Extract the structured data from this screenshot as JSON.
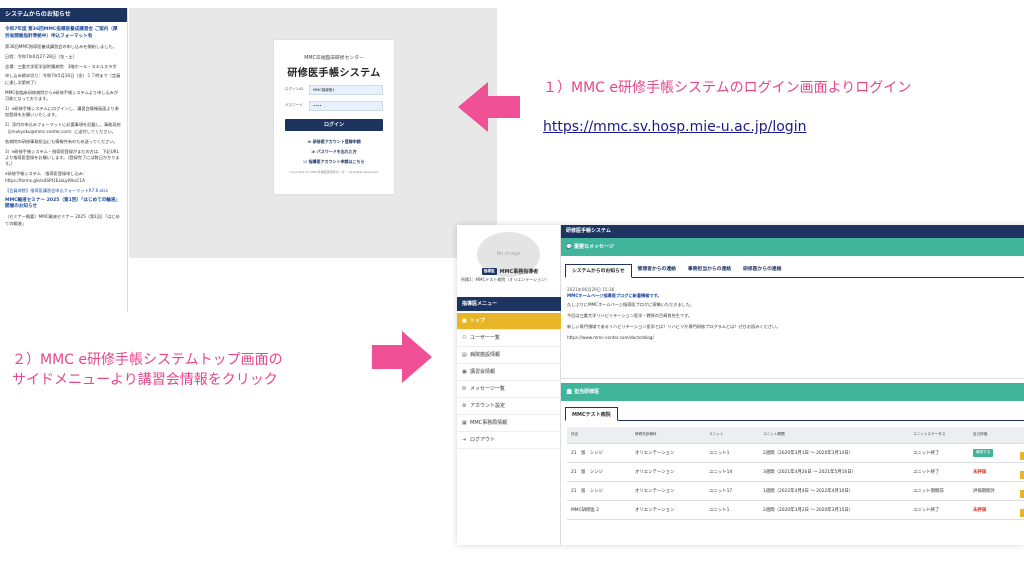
{
  "notice": {
    "header": "システムからのお知らせ",
    "items": [
      {
        "title": "令和7年度 第36回MMC指導医養成講習会 ご案内（厚労省開催指針準拠中）申込フォーマット有",
        "body": "第36回MMC指導医養成講習会の申し込みを開始しました。"
      },
      {
        "body": "日程：令和7年6月27-28日（金・土）"
      },
      {
        "body": "会場：三重大学医学部附属病院　3階ホール・スキルスラボ"
      },
      {
        "body": "申し込み締め切り：令和7年5月16日（金）１７時まで（定員に達し次第終了）"
      },
      {
        "body": "MMC各臨床研修病院からe研修手帳システムより申し込みが可能となっております。"
      },
      {
        "body": "1）e研修手帳システムにログインし、講習会情報画面より参加登録をお願いいたします。"
      },
      {
        "body": "2）添付の申込みフォーマットに必要事項を記載し、事務局宛（jimukyoku@mmc-center.com）に送付してください。"
      },
      {
        "body": "各病院の研修事務担当にも情報共有のため送ってください。"
      },
      {
        "body": "3）e研修手帳システム・指導医登録がまだの方は、下記URLより指導医登録をお願いします。（登録完了には数日かかります。）"
      },
      {
        "body": "e研修手帳システム　指導医登録申し込み：https://forms.gle/o4SPt1EzoLyt9ksC1A"
      },
      {
        "link": "【会員病院】指導医講習会申込フォーマットR7.6.xlsx"
      },
      {
        "title": "MMC輸液セミナー 2025（第1回）「はじめての輸液」開催のお知らせ",
        "body": "（セミナー概要）MMC輸液セミナー 2025（第1回）「はじめての輸液」"
      }
    ]
  },
  "login": {
    "subtitle": "MMC卒後臨床研修センター",
    "title": "研修医手帳システム",
    "id_label": "ログインID",
    "id_value": "MMC指導医1",
    "pw_label": "パスワード",
    "pw_value": "••••",
    "login_button": "ログイン",
    "link_register": "≫ 研修医アカウント登録申請",
    "link_forgot": "≫ パスワードを忘れた方",
    "link_guide": "☑ 指導医アカウント申請はこちら",
    "copyright": "Copyright (C) MMC卒後臨床研修センター All Rights Reserved."
  },
  "captions": {
    "step1": "１）MMC e研修手帳システムのログイン画面よりログイン",
    "url": "https://mmc.sv.hosp.mie-u.ac.jp/login",
    "step2_line1": "２）MMC e研修手帳システムトップ画面の",
    "step2_line2": "サイドメニューより講習会情報をクリック"
  },
  "app": {
    "header": "研修医手帳システム",
    "no_image": "No image",
    "role_badge": "指導医",
    "user_name": "MMC事務指導者",
    "institution": "所属1：MMCテスト病院（オリエンテーション）",
    "menu_header": "指導医メニュー",
    "menu": [
      {
        "icon": "■",
        "label": "トップ"
      },
      {
        "icon": "⚇",
        "label": "ユーザー一覧"
      },
      {
        "icon": "▤",
        "label": "病院施設情報"
      },
      {
        "icon": "▣",
        "label": "講習会情報"
      },
      {
        "icon": "✉",
        "label": "メッセージ一覧"
      },
      {
        "icon": "⚙",
        "label": "アカウント設定"
      },
      {
        "icon": "▦",
        "label": "MMC事務局情報"
      },
      {
        "icon": "⇥",
        "label": "ログアウト"
      }
    ],
    "important_bar": "💬 重要なメッセージ",
    "tabs": [
      "システムからのお知らせ",
      "管理者からの連絡",
      "事務担当からの連絡",
      "研修医からの連絡"
    ],
    "message": {
      "date": "2021年06月29日 15:36",
      "title": "MMCホームページ指導医ブログに新着情報です。",
      "lines": [
        "久しぶりにMMCホームページ指導医ブログに寄稿いただきました。",
        "今回は三重大学リハビリテーション医学・教授の百崎良先生です。",
        "新しい専門領域であるリハビリテーション医学とは？リハビリか専門研修プログラムとは？ぜひお読みください。",
        "https://www.mmc-center.com/doctorblog/"
      ]
    },
    "training_bar": "🏛 担当研修医",
    "sub_tab": "MMCテスト病院",
    "table": {
      "headers": [
        "氏名",
        "研修先診療科",
        "ユニット",
        "ユニット期間",
        "ユニットステータス",
        "自己評価"
      ],
      "rows": [
        {
          "name": "21　留　シンジ",
          "dept": "オリエンテーション",
          "unit": "ユニット1",
          "period": "2週間（2020年3月1日 ～ 2020年3月14日）",
          "status": "ユニット終了",
          "eval": "確認する",
          "eval_type": "button"
        },
        {
          "name": "21　留　シンジ",
          "dept": "オリエンテーション",
          "unit": "ユニット14",
          "period": "3週間（2021年4月26日 ～ 2021年5月16日）",
          "status": "ユニット終了",
          "eval": "未評価",
          "eval_type": "red"
        },
        {
          "name": "21　留　シンジ",
          "dept": "オリエンテーション",
          "unit": "ユニット17",
          "period": "1週間（2022年4月4日 ～ 2022年4月10日）",
          "status": "ユニット期間前",
          "eval": "評価期間外",
          "eval_type": "plain"
        },
        {
          "name": "MMC研修医 2",
          "dept": "オリエンテーション",
          "unit": "ユニット1",
          "period": "2週間（2020年3月2日 ～ 2020年3月15日）",
          "status": "ユニット終了",
          "eval": "未評価",
          "eval_type": "red"
        }
      ]
    }
  },
  "colors": {
    "navy": "#1d3461",
    "teal": "#40b59c",
    "gold": "#e8b428",
    "pink": "#e8458b"
  }
}
